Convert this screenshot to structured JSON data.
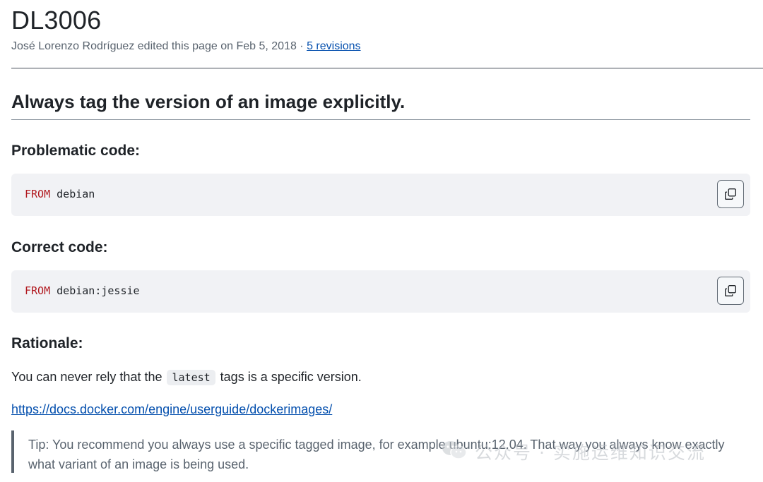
{
  "page": {
    "title": "DL3006",
    "meta": {
      "editor_line": "José Lorenzo Rodríguez edited this page on Feb 5, 2018 · ",
      "revisions_label": "5 revisions"
    }
  },
  "content": {
    "heading": "Always tag the version of an image explicitly.",
    "problematic": {
      "heading": "Problematic code:",
      "keyword": "FROM",
      "code": " debian"
    },
    "correct": {
      "heading": "Correct code:",
      "keyword": "FROM",
      "code": " debian:jessie"
    },
    "rationale": {
      "heading": "Rationale:",
      "text_before": "You can never rely that the ",
      "inline_code": "latest",
      "text_after": " tags is a specific version.",
      "link": "https://docs.docker.com/engine/userguide/dockerimages/"
    },
    "tip": "Tip: You recommend you always use a specific tagged image, for example ubuntu:12.04. That way you always know exactly what variant of an image is being used."
  },
  "watermark": {
    "text": "公众号 · 实施运维知识交流",
    "icon": "wechat-icon"
  },
  "icons": {
    "copy": "copy-icon"
  },
  "colors": {
    "keyword": "#b1181e",
    "link": "#0550ae",
    "code_bg": "#f1f2f5",
    "muted": "#59636e"
  }
}
